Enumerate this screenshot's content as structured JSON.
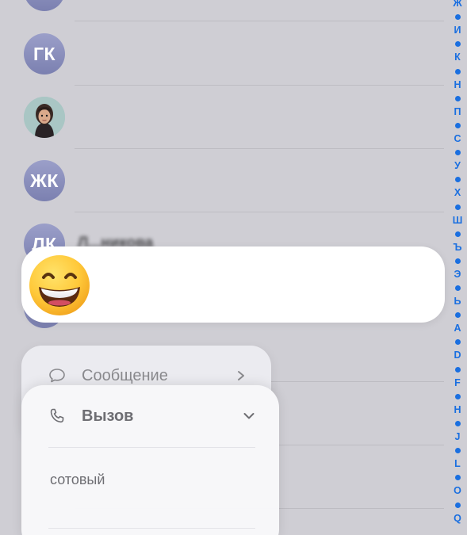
{
  "contacts": [
    {
      "initials": ""
    },
    {
      "initials": "ГК"
    },
    {
      "initials": ""
    },
    {
      "initials": "ЖК"
    },
    {
      "initials": "ЛК",
      "name": "Л...никова"
    }
  ],
  "alphabet_index": [
    "Ж",
    "И",
    "К",
    "Н",
    "П",
    "С",
    "У",
    "Х",
    "Ш",
    "Ъ",
    "Э",
    "Ь",
    "A",
    "D",
    "F",
    "H",
    "J",
    "L",
    "O",
    "Q"
  ],
  "reaction": {
    "emoji_name": "grinning-face-with-smiling-eyes"
  },
  "menu": {
    "message_label": "Сообщение",
    "call_label": "Вызов",
    "call_option_label": "сотовый"
  },
  "colors": {
    "background": "#cfced4",
    "avatar": "#8b8fbf",
    "accent_blue": "#1a6fe0",
    "card": "#ffffff"
  }
}
